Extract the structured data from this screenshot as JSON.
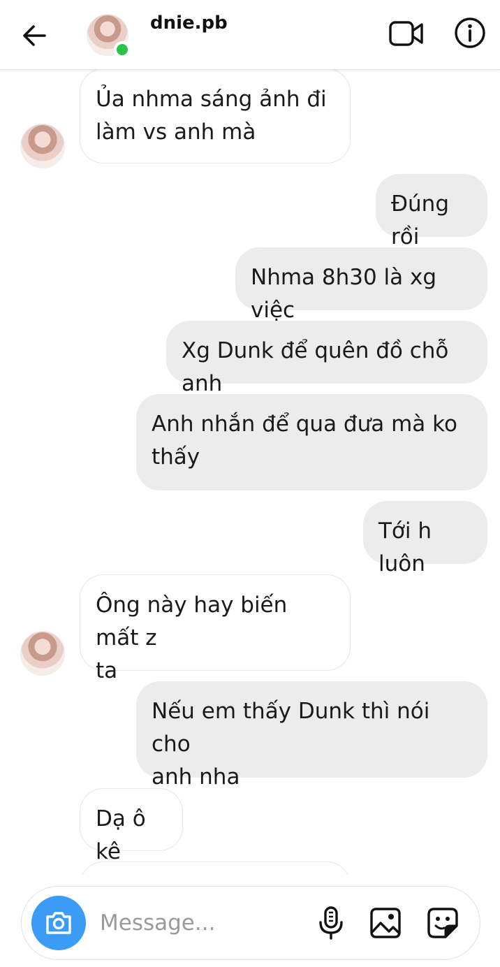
{
  "header": {
    "username": "dnie.pb",
    "icons": {
      "back": "arrow-left-icon",
      "video": "video-camera-icon",
      "info": "info-icon"
    },
    "online_status_color": "#2bc24a"
  },
  "messages": [
    {
      "sender": "them",
      "text": "Ủa nhma sáng ảnh đi\nlàm vs anh mà"
    },
    {
      "sender": "me",
      "text": "Đúng rồi"
    },
    {
      "sender": "me",
      "text": "Nhma 8h30 là xg việc"
    },
    {
      "sender": "me",
      "text": "Xg Dunk để quên đồ chỗ anh"
    },
    {
      "sender": "me",
      "text": "Anh nhắn để qua đưa mà ko\nthấy"
    },
    {
      "sender": "me",
      "text": "Tới h luôn"
    },
    {
      "sender": "them",
      "text": "Ông này hay biến mất z\nta"
    },
    {
      "sender": "me",
      "text": "Nếu em thấy Dunk thì nói cho\nanh nha"
    },
    {
      "sender": "them",
      "text": "Dạ ô kê"
    }
  ],
  "composer": {
    "placeholder": "Message...",
    "icons": [
      "camera-icon",
      "microphone-icon",
      "gallery-icon",
      "sticker-icon"
    ],
    "camera_button_color": "#3b9cf5"
  },
  "colors": {
    "incoming_bubble": "#ffffff",
    "outgoing_bubble": "#ececec"
  }
}
